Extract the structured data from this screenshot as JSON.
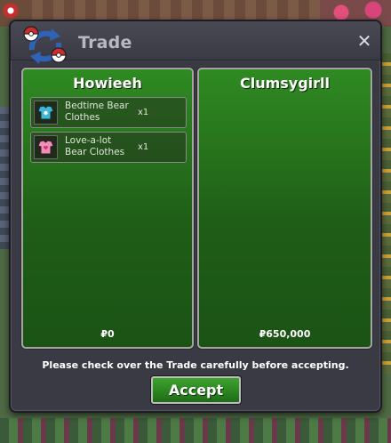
{
  "window": {
    "title": "Trade",
    "close_icon": "close-icon",
    "trade_icon": "trade-swap-icon"
  },
  "left_panel": {
    "player": "Howieeh",
    "items": [
      {
        "name": "Bedtime Bear Clothes",
        "name_line1": "Bedtime Bear",
        "name_line2": "Clothes",
        "qty": "x1",
        "icon": "blue-bear-clothes-icon",
        "icon_color": "#3fb7d6"
      },
      {
        "name": "Love-a-lot Bear Clothes",
        "name_line1": "Love-a-lot",
        "name_line2": "Bear Clothes",
        "qty": "x1",
        "icon": "pink-bear-clothes-icon",
        "icon_color": "#f08fb8"
      }
    ],
    "money": "₽0"
  },
  "right_panel": {
    "player": "Clumsygirll",
    "items": [],
    "money": "₽650,000"
  },
  "footer": {
    "warning": "Please check over the Trade carefully before accepting.",
    "accept_label": "Accept"
  },
  "colors": {
    "panel_green": "#2f8a22",
    "window_bg": "#3a3a44",
    "accept_green": "#3ca42e"
  }
}
